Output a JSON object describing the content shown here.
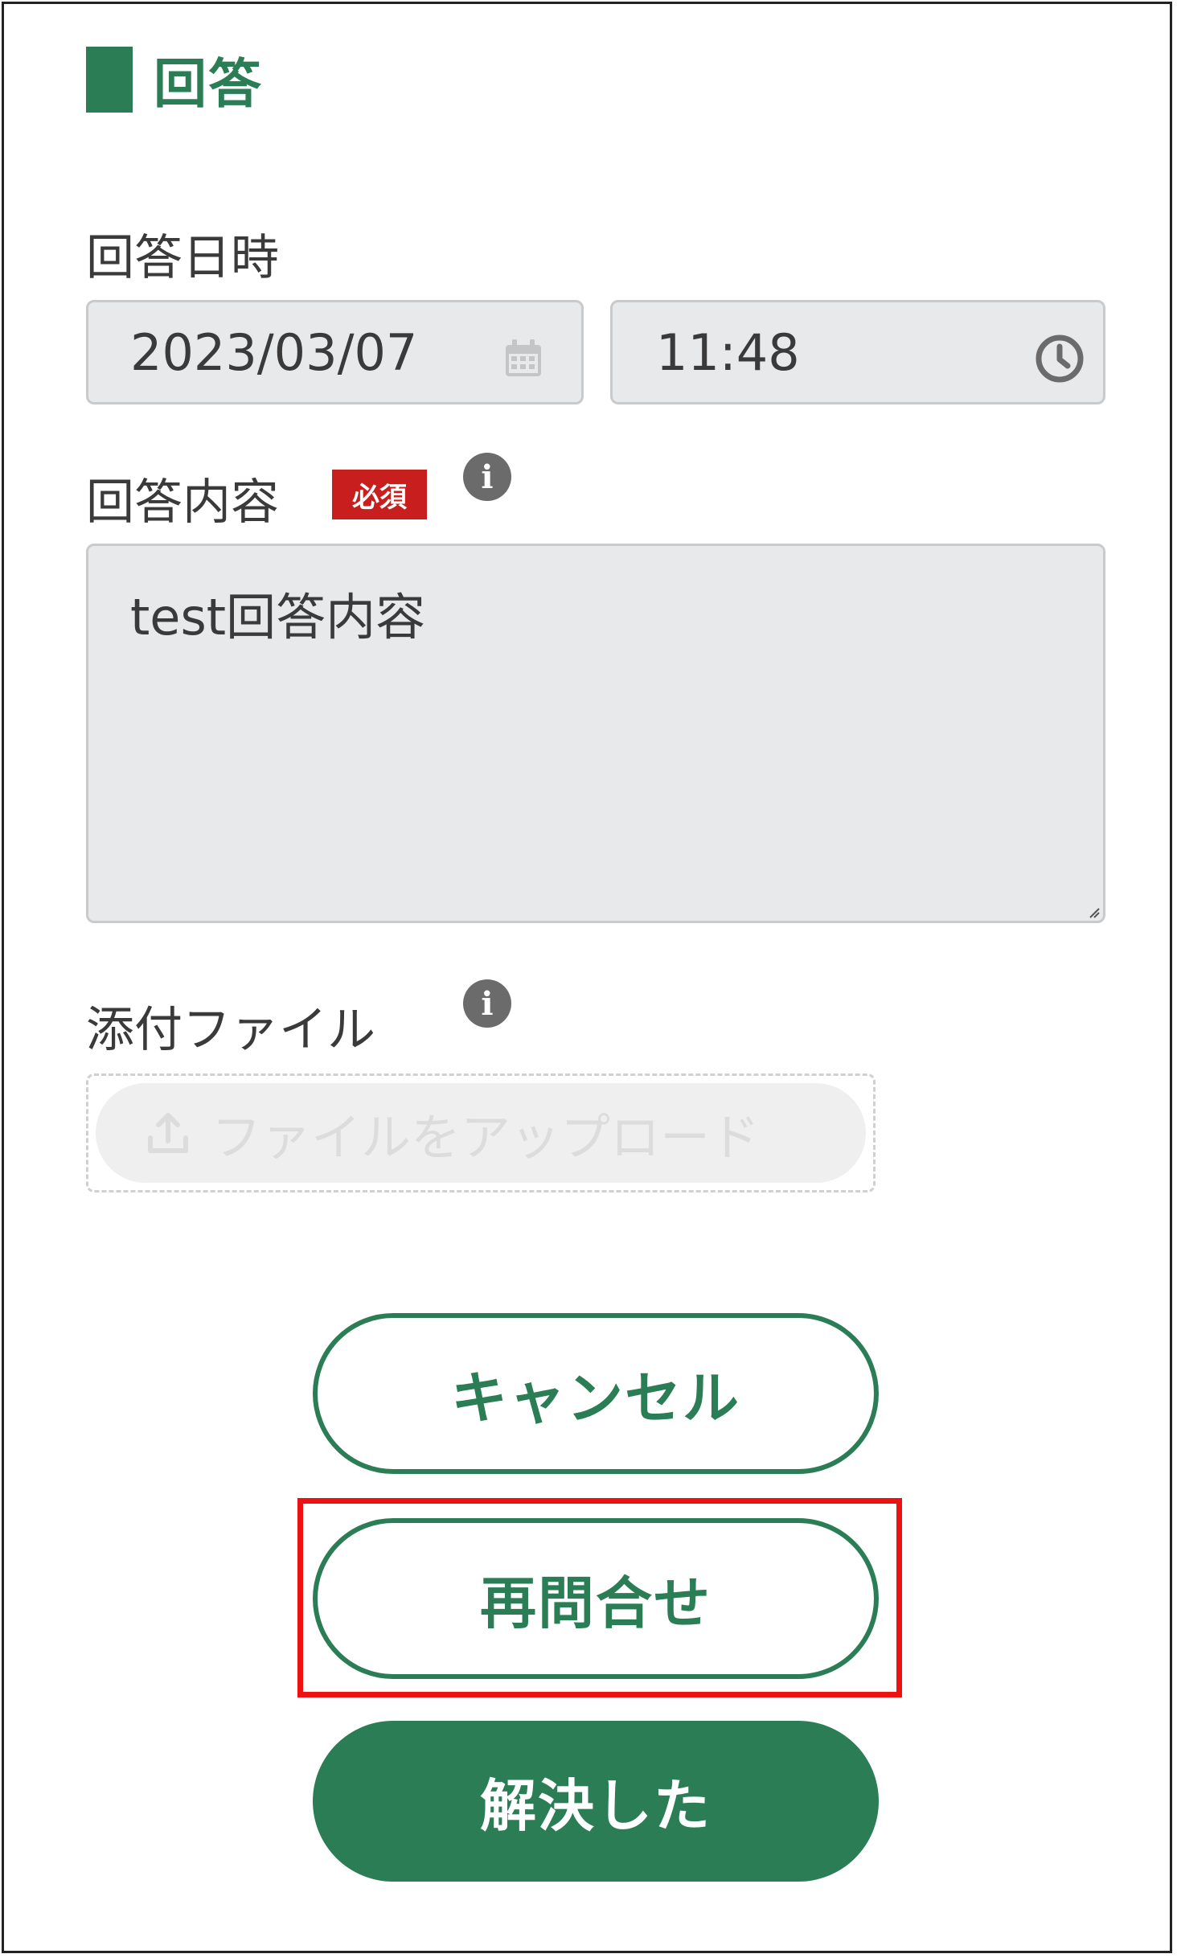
{
  "section": {
    "title": "回答"
  },
  "answer_datetime": {
    "label": "回答日時",
    "date_value": "2023/03/07",
    "time_value": "11:48",
    "date_icon": "calendar-icon",
    "time_icon": "clock-icon"
  },
  "answer_content": {
    "label": "回答内容",
    "required_badge": "必須",
    "value": "test回答内容",
    "info_icon": "info-icon"
  },
  "attachment": {
    "label": "添付ファイル",
    "upload_label": "ファイルをアップロード",
    "upload_icon": "upload-icon",
    "info_icon": "info-icon"
  },
  "actions": {
    "cancel_label": "キャンセル",
    "reinquire_label": "再問合せ",
    "resolved_label": "解決した"
  },
  "colors": {
    "brand_green": "#2a7d55",
    "required_red": "#c81e1e",
    "highlight_red": "#ee1111",
    "field_bg": "#e8e9eb"
  }
}
